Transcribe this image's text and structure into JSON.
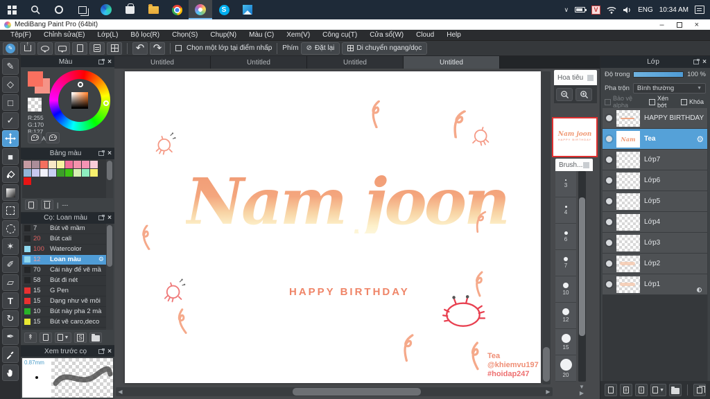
{
  "taskbar": {
    "time": "10:34 AM",
    "language": "ENG",
    "tray_chevron": "∨",
    "icons": [
      "start",
      "search",
      "cortana",
      "task-view",
      "edge",
      "store",
      "file-explorer",
      "chrome",
      "medibang-active",
      "skype",
      "photos"
    ]
  },
  "window": {
    "title": "MediBang Paint Pro (64bit)",
    "minimize": "–",
    "close": "×"
  },
  "menu": {
    "items": [
      "Tệp(F)",
      "Chỉnh sửa(E)",
      "Lớp(L)",
      "Bộ lọc(R)",
      "Chọn(S)",
      "Chụp(N)",
      "Màu (C)",
      "Xem(V)",
      "Công cụ(T)",
      "Cửa sổ(W)",
      "Cloud",
      "Help"
    ]
  },
  "toolbar": {
    "undo": "↶",
    "redo": "↷",
    "select_layer_checkbox": "Chọn một lớp tại điểm nhấp",
    "key_label": "Phím",
    "reset_button": "Đặt lại",
    "reset_icon": "⊘",
    "move_button": "Di chuyển ngang/dọc"
  },
  "tabs": [
    {
      "label": "Untitled"
    },
    {
      "label": "Untitled"
    },
    {
      "label": "Untitled"
    },
    {
      "label": "Untitled"
    }
  ],
  "color_panel": {
    "title": "Màu",
    "r": "R:255",
    "g": "G:170",
    "b": "B:127",
    "hex": "#FFAA7F",
    "foreground": "#f9705f",
    "secondary": "#f59387"
  },
  "palette_panel": {
    "title": "Bảng màu",
    "empty_value": "---",
    "row1": [
      "#c59aa2",
      "#ab8d99",
      "#f4705f",
      "#f7e9c6",
      "#f7f3a2",
      "#f2719b",
      "#f593ac",
      "#f593b4",
      "#f8ccd8",
      "#92b4d8"
    ],
    "row2": [
      "#c8c8f0",
      "#f2f2fa",
      "#c8d0f2",
      "#3c9e28",
      "#3ec414",
      "#d8f0b4",
      "#8ef0c0",
      "#f7f06e",
      "#e81414"
    ]
  },
  "brush_panel": {
    "title": "Cọ: Loan màu",
    "gear": "⚙",
    "brushes": [
      {
        "size": "7",
        "name": "Bút vẽ mầm",
        "swatch": "#242628",
        "size_color": "#d8dbde"
      },
      {
        "size": "20",
        "name": "Bút cali",
        "swatch": "#242628",
        "size_color": "#e06060"
      },
      {
        "size": "100",
        "name": "Watercolor",
        "swatch": "#8fd8ef",
        "size_color": "#e06060"
      },
      {
        "size": "12",
        "name": "Loan màu",
        "swatch": "#8fd8ef",
        "size_color": "#f2a0a0"
      },
      {
        "size": "70",
        "name": "Cái này để vẽ mầ",
        "swatch": "#242628",
        "size_color": "#d8dbde"
      },
      {
        "size": "58",
        "name": "Bút đi nét",
        "swatch": "#242628",
        "size_color": "#d8dbde"
      },
      {
        "size": "15",
        "name": "G Pen",
        "swatch": "#e83030",
        "size_color": "#d8dbde"
      },
      {
        "size": "15",
        "name": "Dạng như vẽ môi",
        "swatch": "#e83030",
        "size_color": "#d8dbde"
      },
      {
        "size": "10",
        "name": "Bút này pha 2 mà",
        "swatch": "#28b428",
        "size_color": "#d8dbde"
      },
      {
        "size": "15",
        "name": "Bút vẽ caro,deco",
        "swatch": "#e8e832",
        "size_color": "#d8dbde"
      }
    ]
  },
  "brush_preview": {
    "title": "Xem trước cọ",
    "size_label": "0.87mm"
  },
  "navigator": {
    "title": "Hoa tiêu"
  },
  "brush_sizes": {
    "title": "Brush...",
    "sizes": [
      "3",
      "4",
      "6",
      "7",
      "10",
      "12",
      "15",
      "20"
    ]
  },
  "layers_panel": {
    "title": "Lớp",
    "opacity_label": "Độ trong",
    "opacity_value": "100 %",
    "blend_label": "Pha trộn",
    "blend_mode": "Bình thường",
    "alpha_checkbox": "Bảo vệ alpha",
    "clip_checkbox": "Xén bớt",
    "lock_checkbox": "Khóa",
    "gear": "⚙",
    "layers": [
      {
        "name": "HAPPY BIRTHDAY"
      },
      {
        "name": "Tea"
      },
      {
        "name": "Lớp7"
      },
      {
        "name": "Lớp6"
      },
      {
        "name": "Lớp5"
      },
      {
        "name": "Lớp4"
      },
      {
        "name": "Lớp3"
      },
      {
        "name": "Lớp2"
      },
      {
        "name": "Lớp1"
      }
    ]
  },
  "canvas": {
    "main_text": "Nam joon",
    "subtitle": "HAPPY BIRTHDAY",
    "signature_line1": "Tea",
    "signature_line2": "@khiemvu197",
    "signature_line3": "#hoidap247"
  },
  "colors": {
    "accent_blue": "#4f9cd6",
    "selection_blue": "#55a1d8",
    "artwork_salmon": "#f5a585",
    "artwork_red": "#e84050",
    "current_color": "#FFAA7F"
  }
}
